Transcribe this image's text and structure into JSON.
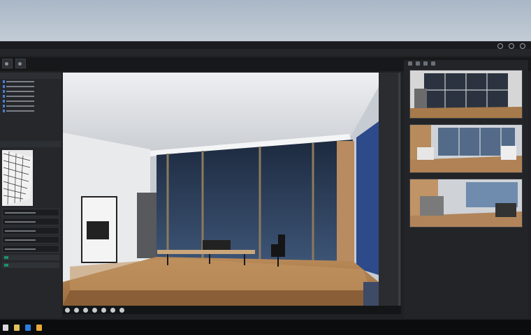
{
  "window": {
    "title": "",
    "menu_items": [
      "",
      "",
      "",
      "",
      "",
      "",
      "",
      "",
      "",
      "",
      "",
      "",
      ""
    ]
  },
  "toolbar": {
    "left_buttons": [
      {
        "icon": "play-icon",
        "label": ""
      },
      {
        "icon": "view-icon",
        "label": ""
      }
    ],
    "right_icons": [
      "camera-icon",
      "grid-icon",
      "snap-icon",
      "render-icon",
      "light-icon",
      "settings-icon"
    ]
  },
  "left_panel": {
    "scene_header": "",
    "layers_header": "",
    "tree_rows": 7,
    "property_rows": 5,
    "timeline_rows": 2
  },
  "viewport": {
    "scene": "office-interior",
    "bottom_icons": [
      "move-icon",
      "rotate-icon",
      "scale-icon",
      "camera-icon",
      "light-icon",
      "render-icon",
      "grid-icon"
    ]
  },
  "right_panel": {
    "cameras": [
      {
        "name": ""
      },
      {
        "name": ""
      },
      {
        "name": ""
      }
    ]
  },
  "taskbar": {
    "apps": [
      {
        "icon": "start-icon",
        "color": "#d9d9d9"
      },
      {
        "icon": "explorer-icon",
        "color": "#e0c15a"
      },
      {
        "icon": "edge-icon",
        "color": "#2b7de1"
      },
      {
        "icon": "folder-icon",
        "color": "#e8a93a"
      }
    ],
    "clock": ""
  },
  "colors": {
    "accent": "#2b6fd6",
    "chip": "#1f8f6a",
    "floor": "#a6794b"
  }
}
